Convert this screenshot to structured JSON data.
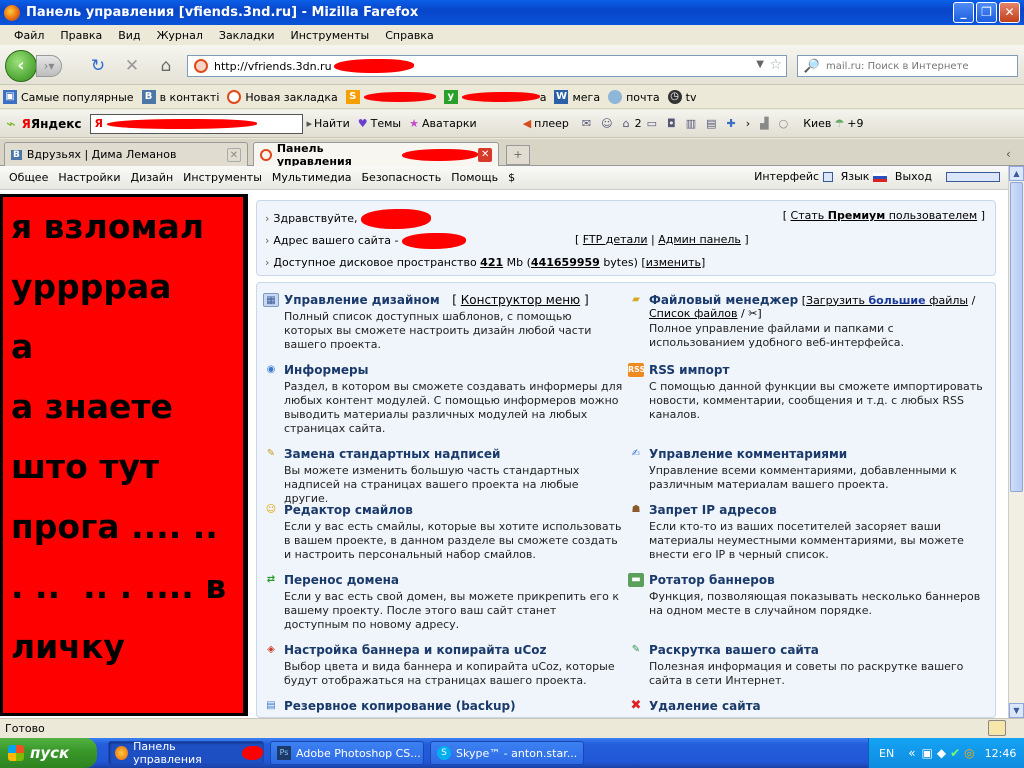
{
  "window": {
    "title": "Панель управления [vfiends.3nd.ru] - Mizilla Farefox"
  },
  "menu": [
    "Файл",
    "Правка",
    "Вид",
    "Журнал",
    "Закладки",
    "Инструменты",
    "Справка"
  ],
  "nav": {
    "url": "http://vfriends.3dn.ru",
    "search_placeholder": "mail.ru: Поиск в Интернете"
  },
  "bookmarks": [
    {
      "label": "Самые популярные",
      "icon": "bookmark-icon"
    },
    {
      "label": "в контакті",
      "icon": "vk-icon"
    },
    {
      "label": "Новая закладка",
      "icon": "ucoz-icon"
    },
    {
      "label": "а",
      "icon": "bookmark-icon"
    },
    {
      "label": "мега",
      "icon": "w-icon"
    },
    {
      "label": "почта",
      "icon": "mail-icon"
    },
    {
      "label": "tv",
      "icon": "clock-icon"
    }
  ],
  "yandex": {
    "logo": "Яндекс",
    "find": "Найти",
    "themes": "Темы",
    "avatars": "Аватарки",
    "player": "плеер",
    "home_count": "2",
    "city": "Киев",
    "temp": "+9"
  },
  "tabs": [
    {
      "label": "Вдрузьях | Дима Леманов",
      "active": false
    },
    {
      "label": "Панель управления",
      "active": true
    }
  ],
  "ucoz_menu": [
    "Общее",
    "Настройки",
    "Дизайн",
    "Инструменты",
    "Мультимедиа",
    "Безопасность",
    "Помощь",
    "$"
  ],
  "ucoz_right": {
    "interface": "Интерфейс",
    "lang": "Язык",
    "exit": "Выход"
  },
  "overlay_text": "я взломал\nурррраа\nа\nа знаете\nшто тут\nпрога .... ..\n. ..  .. . .... в\nличку",
  "info": {
    "hello": "Здравствуйте,",
    "site_address": "Адрес вашего сайта -",
    "disk": "Доступное дисковое пространство",
    "disk_mb": "421",
    "mb": "Mb",
    "disk_bytes": "441659959",
    "bytes": "bytes",
    "change": "изменить",
    "premium_pre": "Стать",
    "premium_bold": "Премиум",
    "premium_post": "пользователем",
    "ftp": "FTP детали",
    "admin": "Админ панель"
  },
  "sections_left": [
    {
      "title": "Управление дизайном",
      "extra": "Конструктор меню",
      "desc": "Полный список доступных шаблонов, с помощью которых вы сможете настроить дизайн любой части вашего проекта.",
      "icon": "design-icon"
    },
    {
      "title": "Информеры",
      "desc": "Раздел, в котором вы сможете создавать информеры для любых контент модулей. С помощью информеров можно выводить материалы различных модулей на любых страницах сайта.",
      "icon": "informer-icon"
    },
    {
      "title": "Замена стандартных надписей",
      "desc": "Вы можете изменить большую часть стандартных надписей на страницах вашего проекта на любые другие.",
      "icon": "text-replace-icon"
    },
    {
      "title": "Редактор смайлов",
      "desc": "Если у вас есть смайлы, которые вы хотите использовать в вашем проекте, в данном разделе вы сможете создать и настроить персональный набор смайлов.",
      "icon": "smiley-icon"
    },
    {
      "title": "Перенос домена",
      "desc": "Если у вас есть свой домен, вы можете прикрепить его к вашему проекту. После этого ваш сайт станет доступным по новому адресу.",
      "icon": "domain-transfer-icon"
    },
    {
      "title": "Настройка баннера и копирайта uCoz",
      "desc": "Выбор цвета и вида баннера и копирайта uCoz, которые будут отображаться на страницах вашего проекта.",
      "icon": "banner-settings-icon"
    },
    {
      "title": "Резервное копирование (backup)",
      "desc": "",
      "icon": "backup-icon"
    }
  ],
  "sections_right": [
    {
      "title": "Файловый менеджер",
      "upload_pre": "Загрузить",
      "upload_bold": "большие",
      "upload_post": "файлы",
      "list": "Список файлов",
      "desc": "Полное управление файлами и папками с использованием удобного веб-интерфейса.",
      "icon": "folder-icon"
    },
    {
      "title": "RSS импорт",
      "desc": "С помощью данной функции вы сможете импортировать новости, комментарии, сообщения и т.д. с любых RSS каналов.",
      "icon": "rss-icon"
    },
    {
      "title": "Управление комментариями",
      "desc": "Управление всеми комментариями, добавленными к различным материалам вашего проекта.",
      "icon": "comments-icon"
    },
    {
      "title": "Запрет IP адресов",
      "desc": "Если кто-то из ваших посетителей засоряет ваши материалы неуместными комментариями, вы можете внести его IP в черный список.",
      "icon": "ip-ban-icon"
    },
    {
      "title": "Ротатор баннеров",
      "desc": "Функция, позволяющая показывать несколько баннеров на одном месте в случайном порядке.",
      "icon": "banner-rotator-icon"
    },
    {
      "title": "Раскрутка вашего сайта",
      "desc": "Полезная информация и советы по раскрутке вашего сайта в сети Интернет.",
      "icon": "promotion-icon"
    },
    {
      "title": "Удаление сайта",
      "desc": "",
      "icon": "delete-icon"
    }
  ],
  "status": "Готово",
  "taskbar": {
    "start": "пуск",
    "tasks": [
      {
        "label": "Панель управления",
        "icon": "firefox-icon",
        "active": true
      },
      {
        "label": "Adobe Photoshop CS...",
        "icon": "photoshop-icon",
        "active": false
      },
      {
        "label": "Skype™ - anton.star...",
        "icon": "skype-icon",
        "active": false
      }
    ],
    "lang": "EN",
    "clock": "12:46"
  },
  "colors": {
    "overlay": "#ff0000",
    "section_title": "#1a3a6b",
    "taskbar": "#245edb",
    "start": "#3b9a2c"
  }
}
